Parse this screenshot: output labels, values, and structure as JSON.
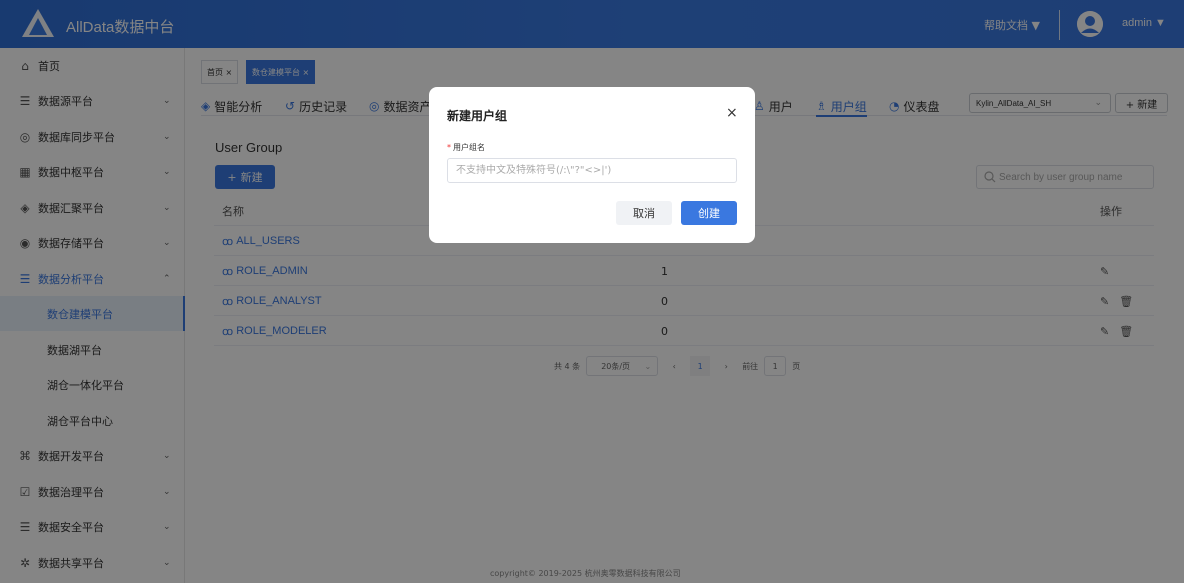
{
  "header": {
    "brand": "AllData数据中台",
    "help": "帮助文档 ▼",
    "user": "admin ▼"
  },
  "sidebar": {
    "items": [
      {
        "label": "首页",
        "icon": "home-icon"
      },
      {
        "label": "数据源平台",
        "icon": "database-icon"
      },
      {
        "label": "数据库同步平台",
        "icon": "sync-icon"
      },
      {
        "label": "数据中枢平台",
        "icon": "grid-icon"
      },
      {
        "label": "数据汇聚平台",
        "icon": "converge-icon"
      },
      {
        "label": "数据存储平台",
        "icon": "storage-icon"
      },
      {
        "label": "数据分析平台",
        "icon": "analysis-icon",
        "active_group": true
      },
      {
        "label": "数仓建模平台",
        "sub": true,
        "active": true
      },
      {
        "label": "数据湖平台",
        "sub": true
      },
      {
        "label": "湖仓一体化平台",
        "sub": true
      },
      {
        "label": "湖仓平台中心",
        "sub": true
      },
      {
        "label": "数据开发平台",
        "icon": "dev-icon"
      },
      {
        "label": "数据治理平台",
        "icon": "governance-icon"
      },
      {
        "label": "数据安全平台",
        "icon": "security-icon"
      },
      {
        "label": "数据共享平台",
        "icon": "share-icon"
      }
    ]
  },
  "tags": [
    {
      "label": "首页 ×"
    },
    {
      "label": "数仓建模平台 ×",
      "active": true
    }
  ],
  "nav_tabs": [
    {
      "label": "智能分析"
    },
    {
      "label": "历史记录"
    },
    {
      "label": "数据资产"
    },
    {
      "label": "用户"
    },
    {
      "label": "用户组",
      "active": true
    },
    {
      "label": "仪表盘"
    }
  ],
  "project_select": "Kylin_AllData_AI_SH",
  "top_new": "+ 新建",
  "section_title": "User Group",
  "add_button": "新建",
  "search_placeholder": "Search by user group name",
  "table": {
    "headers": [
      "名称",
      "操作"
    ],
    "rows": [
      {
        "name": "ALL_USERS",
        "count": "",
        "ops": false
      },
      {
        "name": "ROLE_ADMIN",
        "count": "1",
        "ops": "edit"
      },
      {
        "name": "ROLE_ANALYST",
        "count": "0",
        "ops": "edit-delete"
      },
      {
        "name": "ROLE_MODELER",
        "count": "0",
        "ops": "edit-delete"
      }
    ]
  },
  "pager": {
    "total": "共 4 条",
    "size": "20条/页",
    "current": "1",
    "goto_prefix": "前往",
    "goto_value": "1",
    "goto_suffix": "页"
  },
  "footer": "copyright© 2019-2025 杭州奥零数据科技有限公司",
  "dialog": {
    "title": "新建用户组",
    "field_label": "用户组名",
    "placeholder": "不支持中文及特殊符号(/:\\\"?\"<>|')",
    "cancel": "取消",
    "confirm": "创建"
  }
}
